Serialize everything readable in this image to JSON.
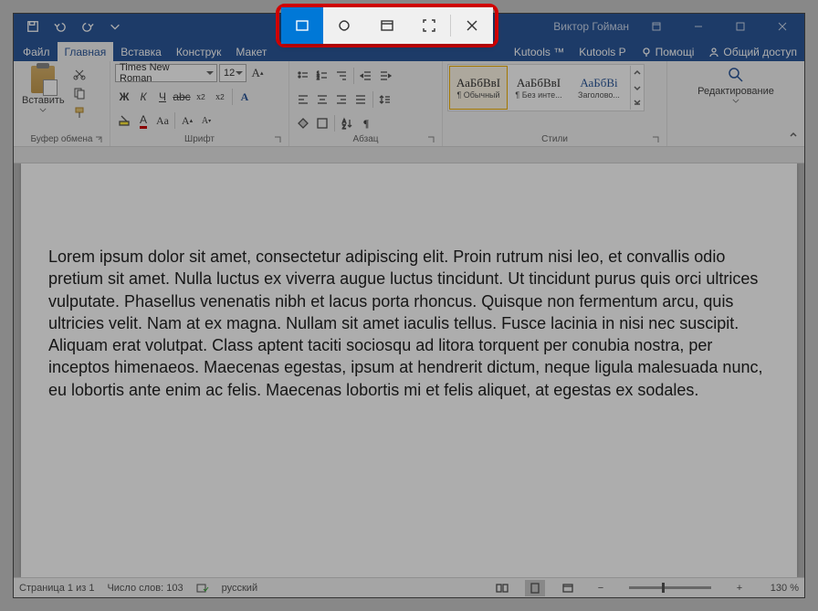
{
  "titlebar": {
    "user": "Виктор Гойман"
  },
  "tabs": {
    "file": "Файл",
    "home": "Главная",
    "insert": "Вставка",
    "design": "Конструк",
    "layout": "Макет",
    "kutools": "Kutools ™",
    "kutoolsp": "Kutools P",
    "help": "Помощі",
    "share": "Общий доступ"
  },
  "ribbon": {
    "clipboard": {
      "label": "Буфер обмена",
      "paste": "Вставить"
    },
    "font": {
      "label": "Шрифт",
      "name": "Times New Roman",
      "size": "12"
    },
    "paragraph": {
      "label": "Абзац"
    },
    "styles": {
      "label": "Стили",
      "items": [
        {
          "preview": "АаБбВвІ",
          "name": "¶ Обычный"
        },
        {
          "preview": "АаБбВвІ",
          "name": "¶ Без инте..."
        },
        {
          "preview": "АаБбВі",
          "name": "Заголово..."
        }
      ]
    },
    "editing": {
      "label": "Редактирование"
    }
  },
  "document": {
    "body": "Lorem ipsum dolor sit amet, consectetur adipiscing elit. Proin rutrum nisi leo, et convallis odio pretium sit amet. Nulla luctus ex viverra augue luctus tincidunt. Ut tincidunt purus quis orci ultrices vulputate. Phasellus venenatis nibh et lacus porta rhoncus. Quisque non fermentum arcu, quis ultricies velit. Nam at ex magna. Nullam sit amet iaculis tellus. Fusce lacinia in nisi nec suscipit. Aliquam erat volutpat. Class aptent taciti sociosqu ad litora torquent per conubia nostra, per inceptos himenaeos. Maecenas egestas, ipsum at hendrerit dictum, neque ligula malesuada nunc, eu lobortis ante enim ac felis. Maecenas lobortis mi et felis aliquet, at egestas ex sodales."
  },
  "status": {
    "page": "Страница 1 из 1",
    "words": "Число слов: 103",
    "lang": "русский",
    "zoom": "130 %"
  }
}
